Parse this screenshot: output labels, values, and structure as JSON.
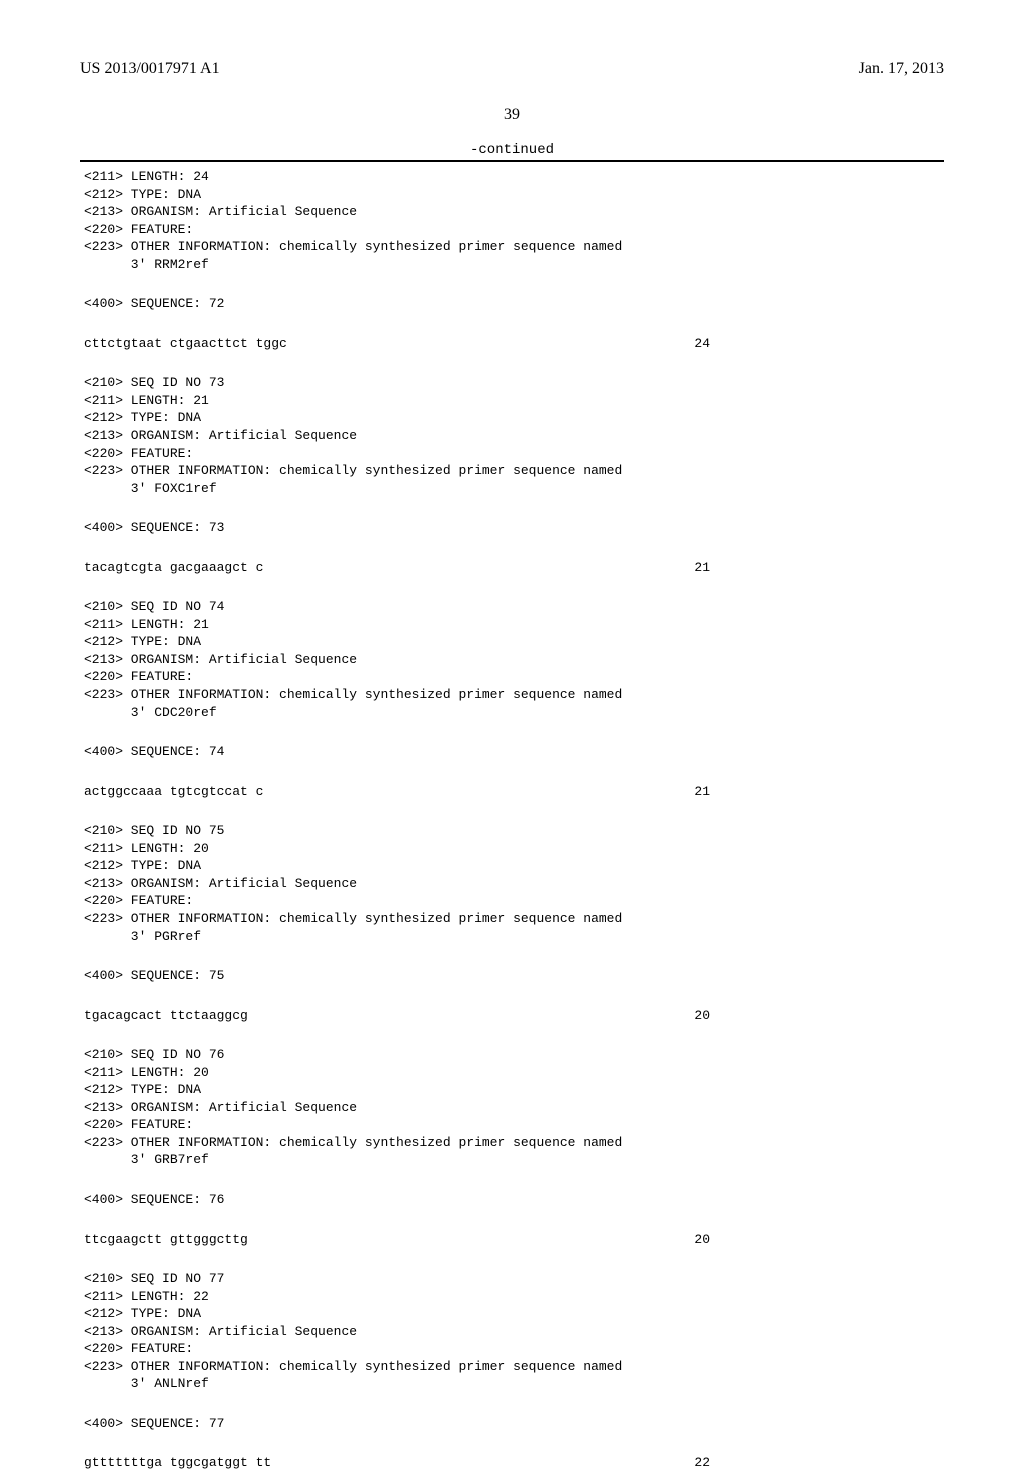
{
  "header": {
    "pubId": "US 2013/0017971 A1",
    "date": "Jan. 17, 2013"
  },
  "pageNumber": "39",
  "continued": "-continued",
  "entries": [
    {
      "meta": "<211> LENGTH: 24\n<212> TYPE: DNA\n<213> ORGANISM: Artificial Sequence\n<220> FEATURE:\n<223> OTHER INFORMATION: chemically synthesized primer sequence named\n      3' RRM2ref",
      "seqLabel": "<400> SEQUENCE: 72",
      "sequence": "cttctgtaat ctgaacttct tggc",
      "length": "24"
    },
    {
      "meta": "<210> SEQ ID NO 73\n<211> LENGTH: 21\n<212> TYPE: DNA\n<213> ORGANISM: Artificial Sequence\n<220> FEATURE:\n<223> OTHER INFORMATION: chemically synthesized primer sequence named\n      3' FOXC1ref",
      "seqLabel": "<400> SEQUENCE: 73",
      "sequence": "tacagtcgta gacgaaagct c",
      "length": "21"
    },
    {
      "meta": "<210> SEQ ID NO 74\n<211> LENGTH: 21\n<212> TYPE: DNA\n<213> ORGANISM: Artificial Sequence\n<220> FEATURE:\n<223> OTHER INFORMATION: chemically synthesized primer sequence named\n      3' CDC20ref",
      "seqLabel": "<400> SEQUENCE: 74",
      "sequence": "actggccaaa tgtcgtccat c",
      "length": "21"
    },
    {
      "meta": "<210> SEQ ID NO 75\n<211> LENGTH: 20\n<212> TYPE: DNA\n<213> ORGANISM: Artificial Sequence\n<220> FEATURE:\n<223> OTHER INFORMATION: chemically synthesized primer sequence named\n      3' PGRref",
      "seqLabel": "<400> SEQUENCE: 75",
      "sequence": "tgacagcact ttctaaggcg",
      "length": "20"
    },
    {
      "meta": "<210> SEQ ID NO 76\n<211> LENGTH: 20\n<212> TYPE: DNA\n<213> ORGANISM: Artificial Sequence\n<220> FEATURE:\n<223> OTHER INFORMATION: chemically synthesized primer sequence named\n      3' GRB7ref",
      "seqLabel": "<400> SEQUENCE: 76",
      "sequence": "ttcgaagctt gttgggcttg",
      "length": "20"
    },
    {
      "meta": "<210> SEQ ID NO 77\n<211> LENGTH: 22\n<212> TYPE: DNA\n<213> ORGANISM: Artificial Sequence\n<220> FEATURE:\n<223> OTHER INFORMATION: chemically synthesized primer sequence named\n      3' ANLNref",
      "seqLabel": "<400> SEQUENCE: 77",
      "sequence": "gtttttttga tggcgatggt tt",
      "length": "22"
    }
  ]
}
